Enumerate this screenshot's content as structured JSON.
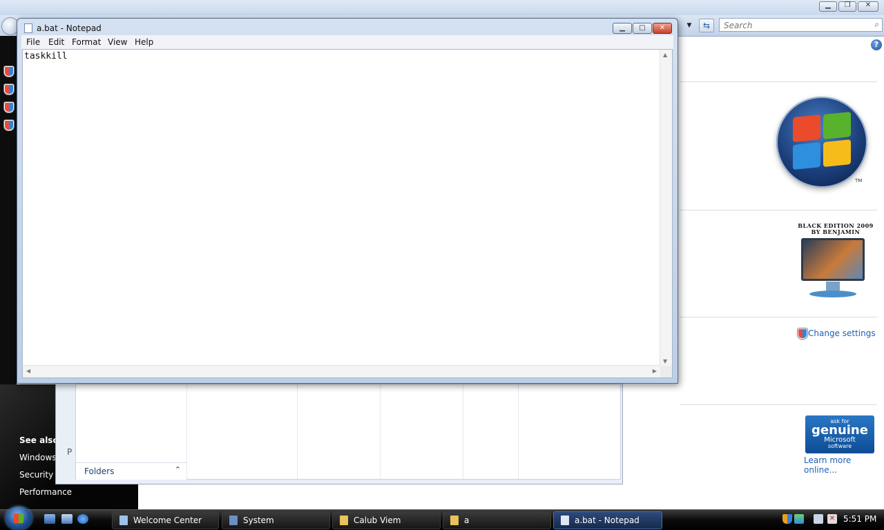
{
  "background_window": {
    "search_placeholder": "Search",
    "oem_title_line1": "BLACK EDITION 2009",
    "oem_title_line2": "BY BENJAMIN",
    "change_settings": "Change settings",
    "genuine_line1": "ask for",
    "genuine_line2": "genuine",
    "genuine_line3": "Microsoft",
    "genuine_line4": "software",
    "learn_more": "Learn more online...",
    "trademark": "TM",
    "see_also_heading": "See also",
    "see_also_links": [
      "Windows",
      "Security Cente",
      "Performance"
    ]
  },
  "explorer": {
    "folders_label": "Folders",
    "stub_text": "P"
  },
  "notepad": {
    "title": "a.bat - Notepad",
    "menu": [
      "File",
      "Edit",
      "Format",
      "View",
      "Help"
    ],
    "content": "taskkill"
  },
  "taskbar": {
    "buttons": [
      "Welcome Center",
      "System",
      "Calub Viem",
      "a",
      "a.bat - Notepad"
    ],
    "active_index": 4,
    "clock": "5:51 PM"
  }
}
